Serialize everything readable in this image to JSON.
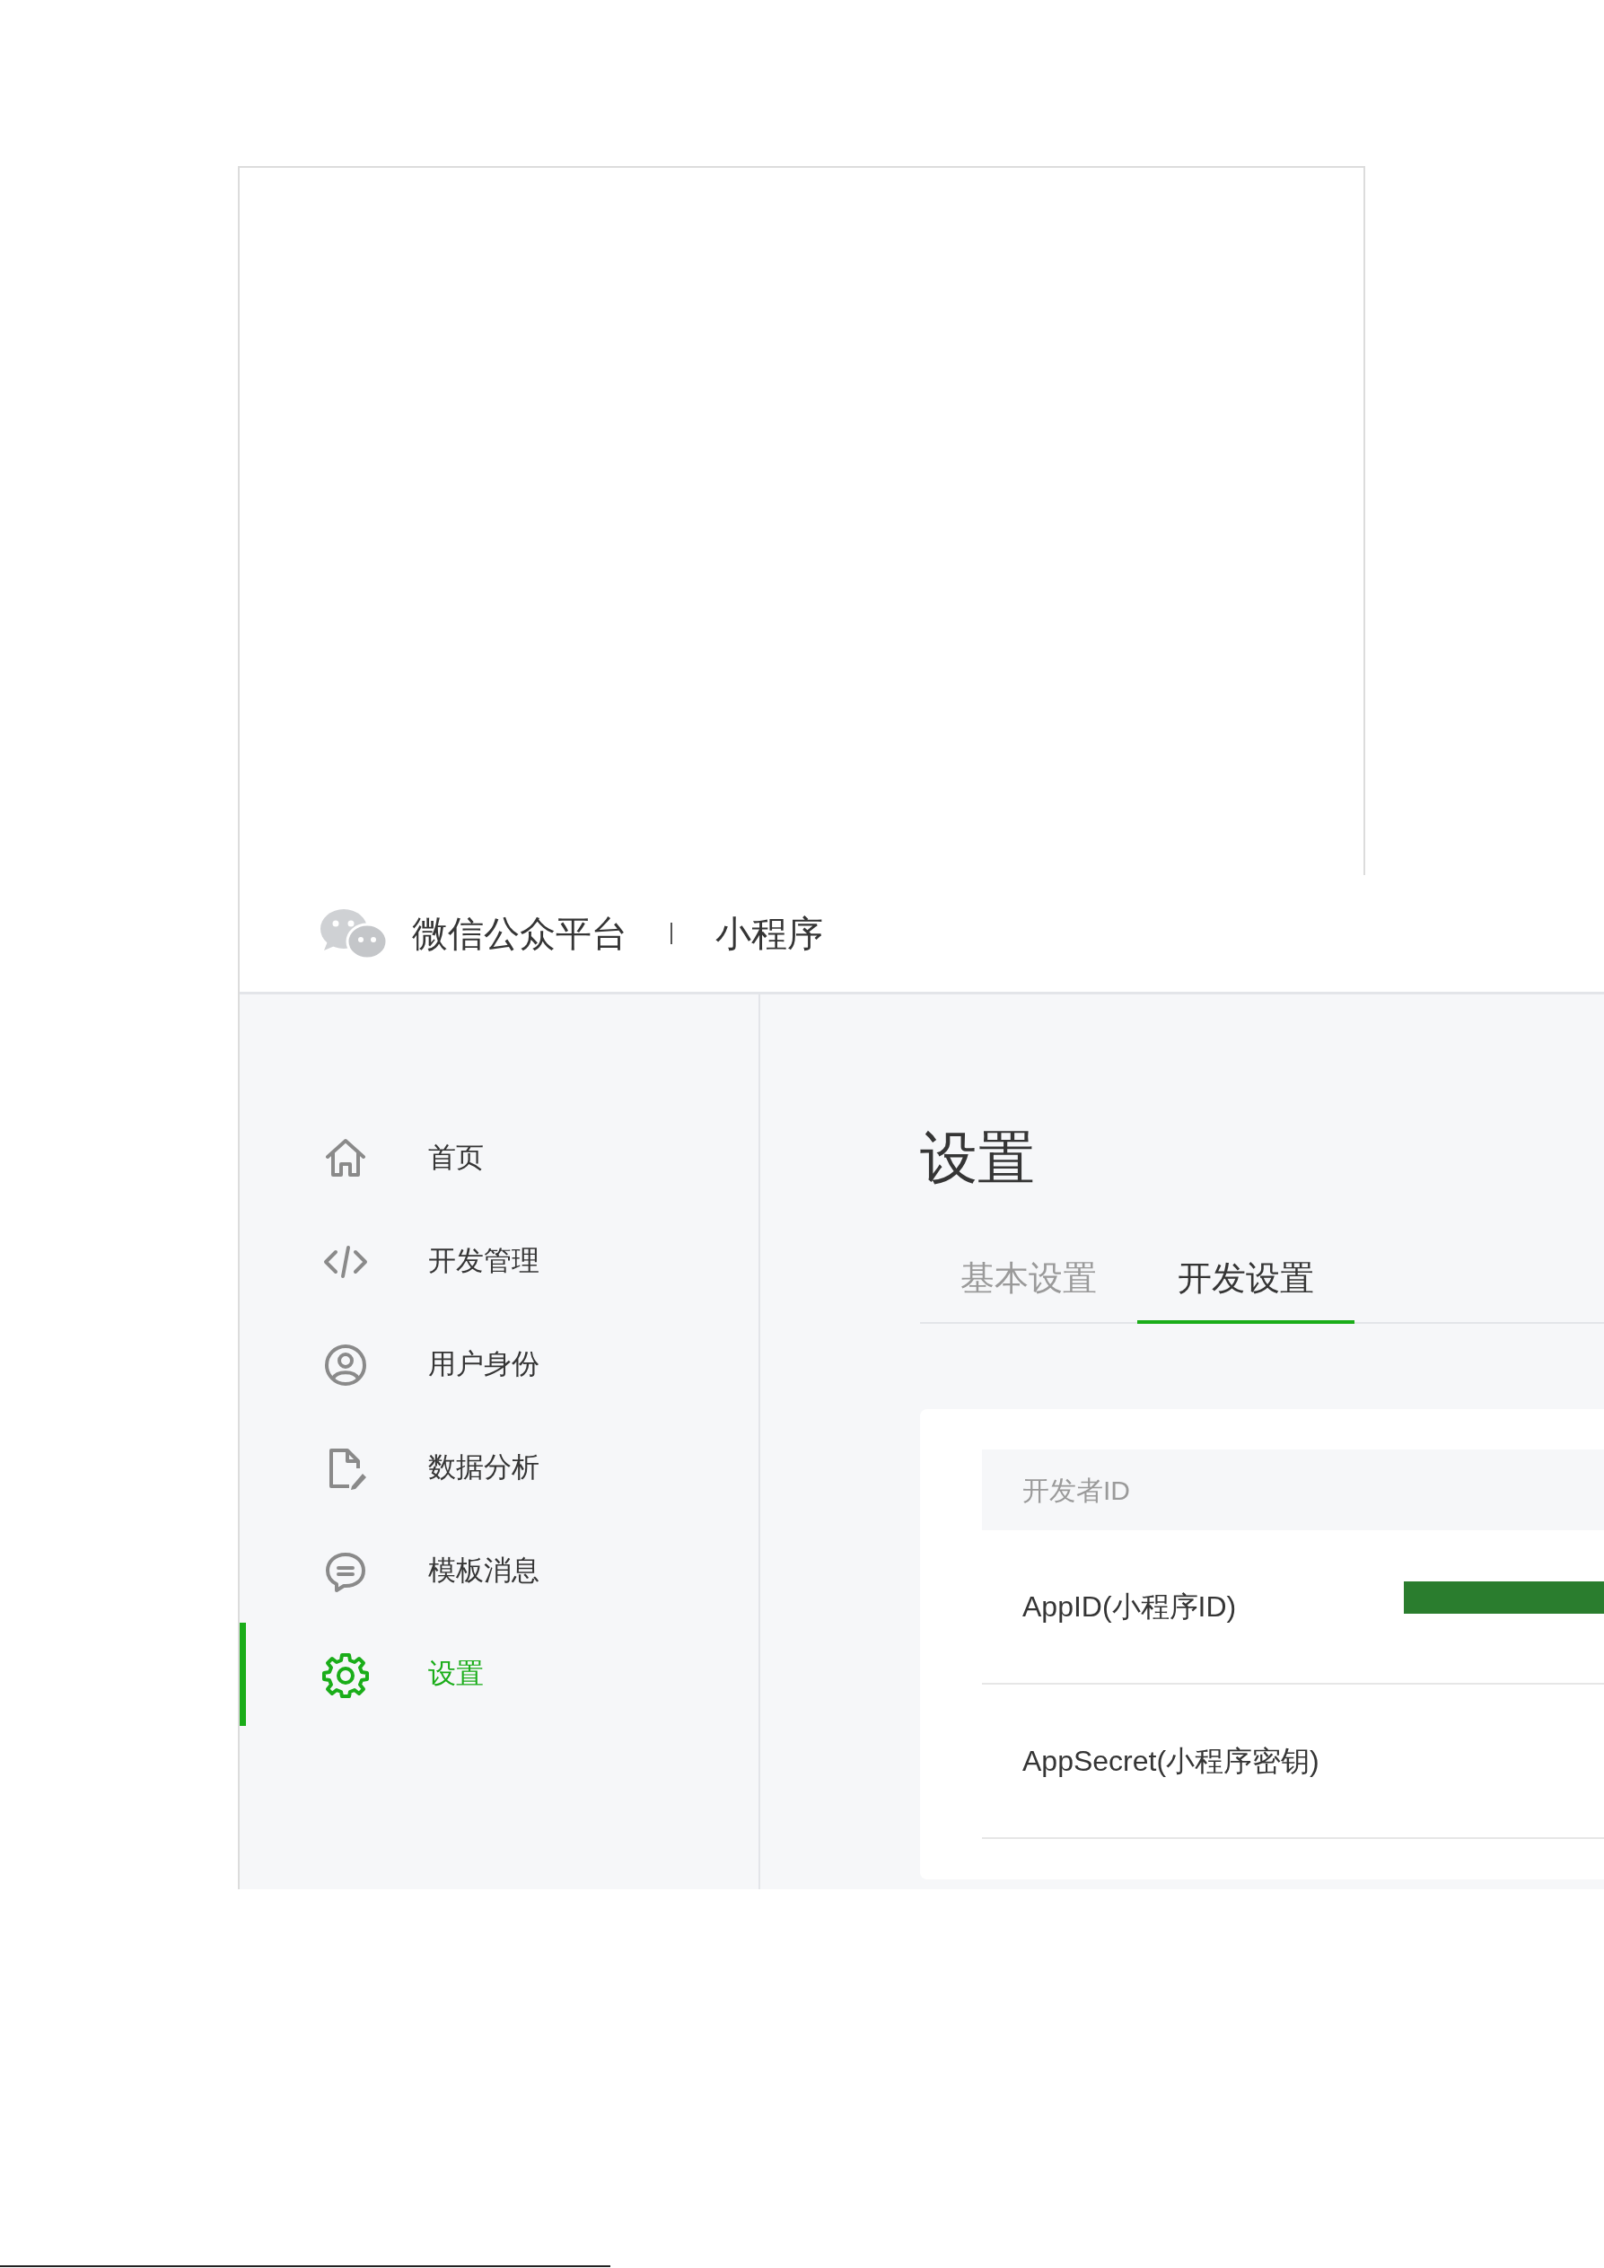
{
  "header": {
    "brand": "微信公众平台",
    "product": "小程序"
  },
  "sidebar": {
    "items": [
      {
        "label": "首页",
        "selected": false
      },
      {
        "label": "开发管理",
        "selected": false
      },
      {
        "label": "用户身份",
        "selected": false
      },
      {
        "label": "数据分析",
        "selected": false
      },
      {
        "label": "模板消息",
        "selected": false
      },
      {
        "label": "设置",
        "selected": true
      }
    ]
  },
  "page_title": "设置",
  "tabs": [
    {
      "label": "基本设置",
      "selected": false
    },
    {
      "label": "开发设置",
      "selected": true
    }
  ],
  "card": {
    "section_title": "开发者ID",
    "rows": [
      {
        "label": "AppID(小程序ID)",
        "redacted": true
      },
      {
        "label": "AppSecret(小程序密钥)",
        "redacted": false
      }
    ]
  }
}
